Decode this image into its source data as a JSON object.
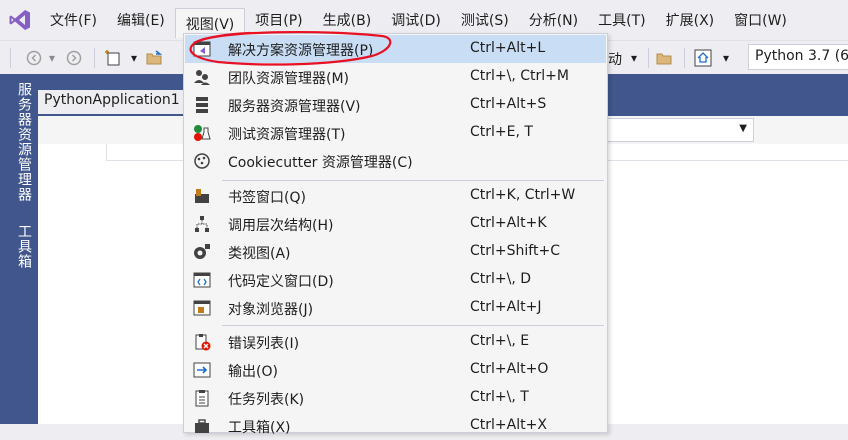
{
  "menubar": {
    "items": [
      "文件(F)",
      "编辑(E)",
      "视图(V)",
      "项目(P)",
      "生成(B)",
      "调试(D)",
      "测试(S)",
      "分析(N)",
      "工具(T)",
      "扩展(X)",
      "窗口(W)"
    ]
  },
  "toolbar": {
    "partial_text": "动",
    "python_env": "Python 3.7 (6"
  },
  "sidedock": {
    "tab1": "服务器资源管理器",
    "tab2": "工具箱"
  },
  "document": {
    "tab_title": "PythonApplication1"
  },
  "view_menu": {
    "items": [
      {
        "label": "解决方案资源管理器(P)",
        "shortcut": "Ctrl+Alt+L",
        "icon": "solution-explorer-icon"
      },
      {
        "label": "团队资源管理器(M)",
        "shortcut": "Ctrl+\\, Ctrl+M",
        "icon": "team-explorer-icon"
      },
      {
        "label": "服务器资源管理器(V)",
        "shortcut": "Ctrl+Alt+S",
        "icon": "server-explorer-icon"
      },
      {
        "label": "测试资源管理器(T)",
        "shortcut": "Ctrl+E, T",
        "icon": "test-explorer-icon"
      },
      {
        "label": "Cookiecutter 资源管理器(C)",
        "shortcut": "",
        "icon": "cookiecutter-icon"
      },
      {
        "label": "书签窗口(Q)",
        "shortcut": "Ctrl+K, Ctrl+W",
        "icon": "bookmark-icon"
      },
      {
        "label": "调用层次结构(H)",
        "shortcut": "Ctrl+Alt+K",
        "icon": "call-hierarchy-icon"
      },
      {
        "label": "类视图(A)",
        "shortcut": "Ctrl+Shift+C",
        "icon": "class-view-icon"
      },
      {
        "label": "代码定义窗口(D)",
        "shortcut": "Ctrl+\\, D",
        "icon": "code-definition-icon"
      },
      {
        "label": "对象浏览器(J)",
        "shortcut": "Ctrl+Alt+J",
        "icon": "object-browser-icon"
      },
      {
        "label": "错误列表(I)",
        "shortcut": "Ctrl+\\, E",
        "icon": "error-list-icon"
      },
      {
        "label": "输出(O)",
        "shortcut": "Ctrl+Alt+O",
        "icon": "output-icon"
      },
      {
        "label": "任务列表(K)",
        "shortcut": "Ctrl+\\, T",
        "icon": "task-list-icon"
      },
      {
        "label": "工具箱(X)",
        "shortcut": "Ctrl+Alt+X",
        "icon": "toolbox-icon"
      }
    ]
  },
  "colors": {
    "accent": "#40568d",
    "highlight": "#c9def5",
    "annotation": "#e81123"
  }
}
